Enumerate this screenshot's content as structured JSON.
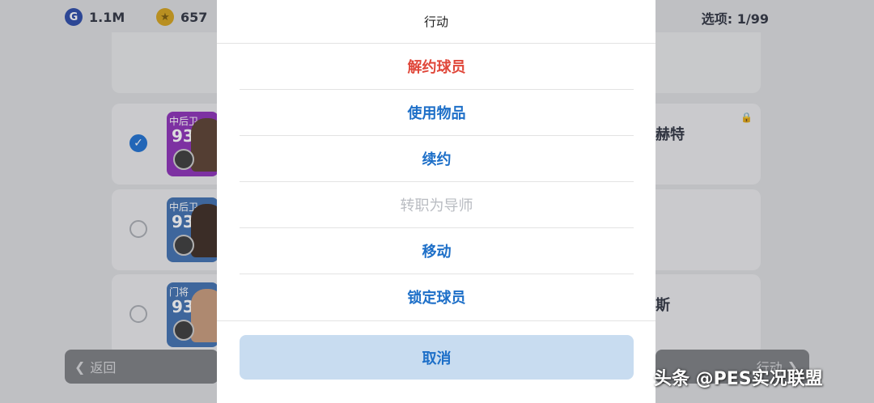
{
  "topbar": {
    "gp_icon": "G",
    "gp_amount": "1.1M",
    "coin_amount": "657",
    "selection": "选项: 1/99"
  },
  "players": [
    {
      "position": "中后卫",
      "rating": "93",
      "name": "赫特",
      "selected": true,
      "locked": true,
      "card_color": "#8c2fb8"
    },
    {
      "position": "中后卫",
      "rating": "93",
      "name": "",
      "selected": false,
      "locked": false,
      "card_color": "#3f6fb0"
    },
    {
      "position": "门将",
      "rating": "93",
      "name": "斯",
      "selected": false,
      "locked": false,
      "card_color": "#3f6fb0"
    }
  ],
  "bottombar": {
    "back_label": "返回",
    "action_label": "行动"
  },
  "action_sheet": {
    "title": "行动",
    "items": [
      {
        "label": "解约球员",
        "style": "danger"
      },
      {
        "label": "使用物品",
        "style": "normal"
      },
      {
        "label": "续约",
        "style": "normal"
      },
      {
        "label": "转职为导师",
        "style": "disabled"
      },
      {
        "label": "移动",
        "style": "normal"
      },
      {
        "label": "锁定球员",
        "style": "normal"
      }
    ],
    "cancel_label": "取消"
  },
  "watermark": "头条 @PES实况联盟",
  "colors": {
    "accent": "#1d6fc8",
    "danger": "#e0473a",
    "disabled": "#b9bcc2",
    "cancel_bg": "#c8dcf0"
  },
  "icons": [
    "gp-coin-icon",
    "star-coin-icon",
    "checkmark-icon",
    "lock-icon",
    "chevron-left-icon",
    "chevron-right-icon"
  ]
}
